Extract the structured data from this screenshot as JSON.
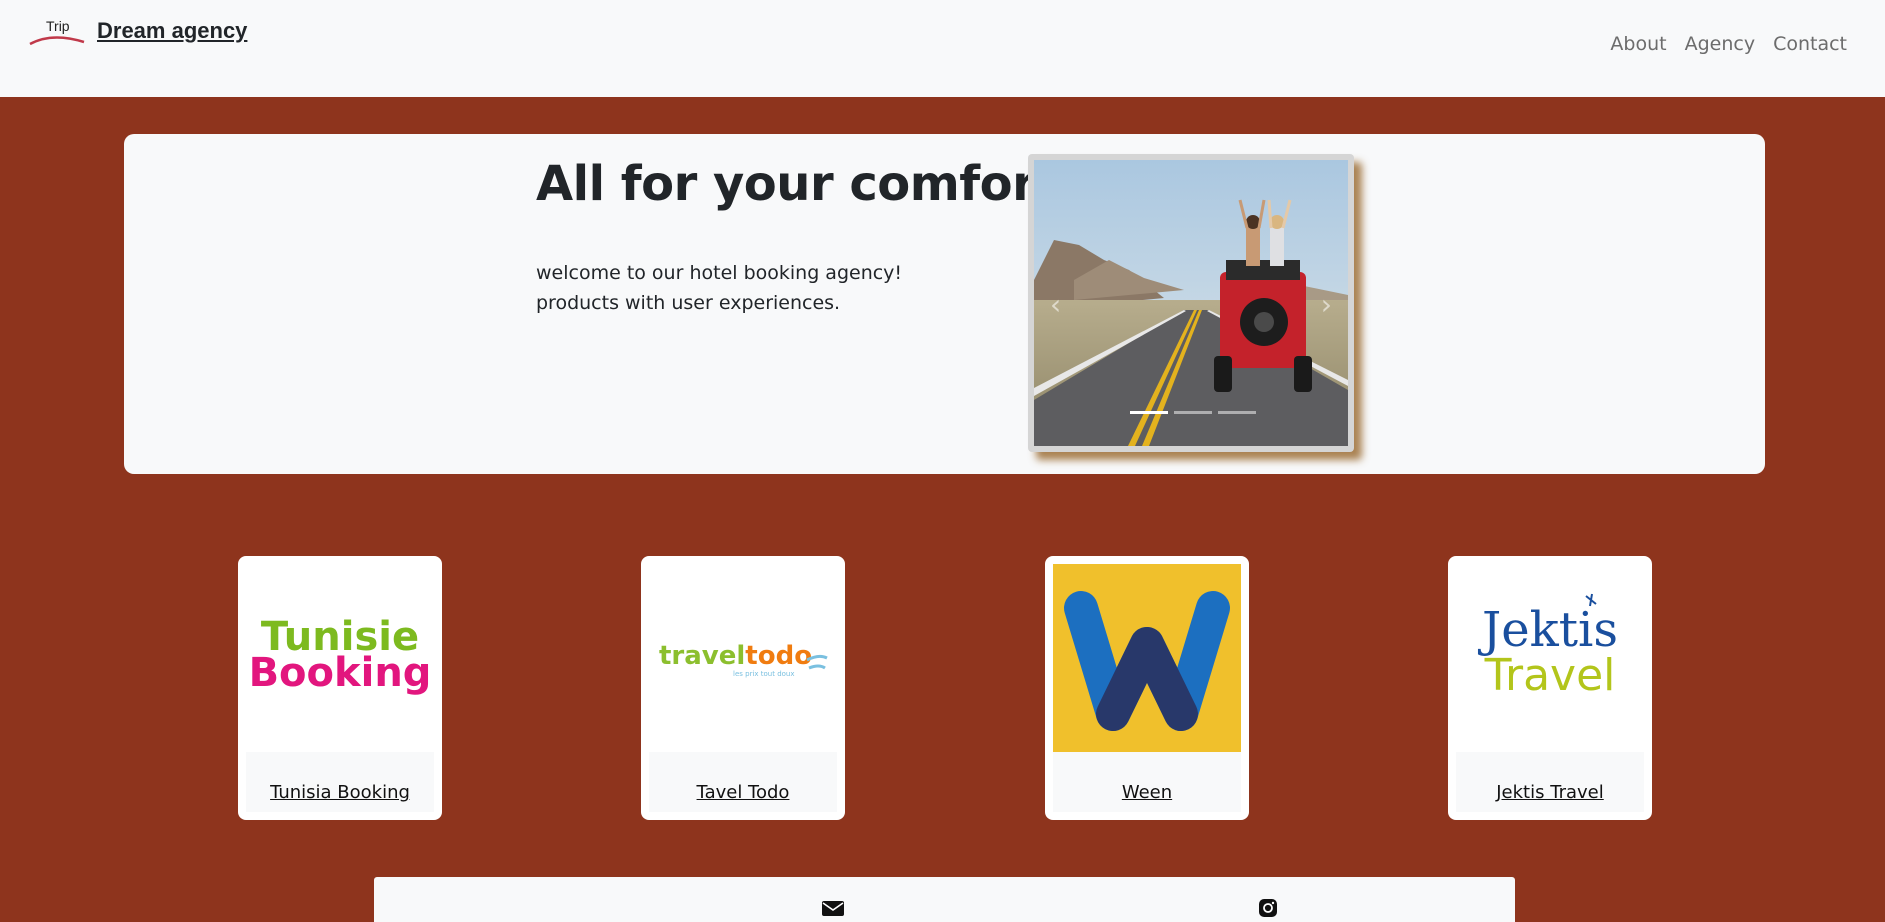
{
  "navbar": {
    "logo_text": "Trip",
    "brand_name": "Dream agency",
    "links": [
      "About",
      "Agency",
      "Contact"
    ]
  },
  "hero": {
    "title": "All for your comfort",
    "text_line1": "welcome to our hotel booking agency!",
    "text_line2": "products with user experiences.",
    "carousel": {
      "prev_icon": "chevron-left-icon",
      "next_icon": "chevron-right-icon",
      "slide_count": 3,
      "active_slide": 1
    }
  },
  "partners": [
    {
      "name": "Tunisia Booking",
      "logo_line1": "Tunisie",
      "logo_line2": "Booking"
    },
    {
      "name": "Tavel Todo",
      "logo_part1": "travel",
      "logo_part2": "todo",
      "logo_tagline": "les prix tout doux"
    },
    {
      "name": "Ween",
      "logo_letter": "W"
    },
    {
      "name": "Jektis Travel",
      "logo_line1": "Jektis",
      "logo_line2": "Travel"
    }
  ],
  "colors": {
    "page_bg": "#8e341d",
    "panel_bg": "#f8f9fa",
    "tunisie_green": "#7dba1f",
    "booking_pink": "#e2167e",
    "travel_green": "#8cbf2e",
    "todo_orange": "#f07c10",
    "ween_yellow": "#f0c02c",
    "ween_blue": "#1c6fc0",
    "jektis_blue": "#1a4f9e",
    "jektis_green": "#b3c51b"
  },
  "footer": {
    "icons": [
      "mail-icon",
      "instagram-icon"
    ]
  }
}
